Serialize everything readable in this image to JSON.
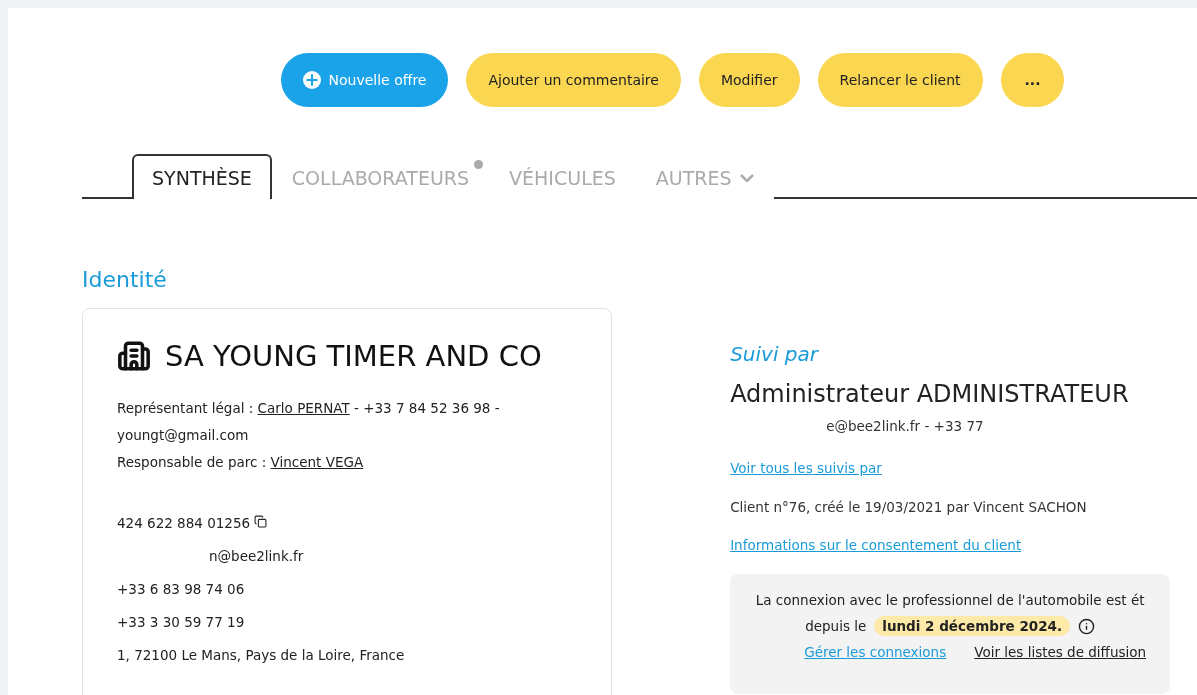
{
  "actions": [
    {
      "label": "Nouvelle offre",
      "kind": "primary"
    },
    {
      "label": "Ajouter un commentaire",
      "kind": "secondary"
    },
    {
      "label": "Modifier",
      "kind": "secondary"
    },
    {
      "label": "Relancer le client",
      "kind": "secondary"
    },
    {
      "label": "...",
      "kind": "more"
    }
  ],
  "tabs": [
    {
      "label": "SYNTHÈSE",
      "selected": true,
      "badge": false,
      "dropdown": false
    },
    {
      "label": "COLLABORATEURS",
      "selected": false,
      "badge": true,
      "dropdown": false
    },
    {
      "label": "VÉHICULES",
      "selected": false,
      "badge": false,
      "dropdown": false
    },
    {
      "label": "AUTRES",
      "selected": false,
      "badge": false,
      "dropdown": true
    }
  ],
  "section_title": "Identité",
  "identity": {
    "company": "SA YOUNG TIMER AND CO",
    "legal_rep": {
      "label": "Représentant légal : ",
      "name": "Carlo PERNAT",
      "details": " - +33 7 84 52 36 98 - youngt@gmail.com"
    },
    "fleet_manager": {
      "label": "Responsable de parc : ",
      "name": "Vincent VEGA"
    },
    "siret": "424 622 884 01256",
    "email": "n@bee2link.fr",
    "phones": [
      "+33 6 83 98 74 06",
      "+33 3 30 59 77 19"
    ],
    "address": "1, 72100 Le Mans, Pays de la Loire, France"
  },
  "followed": {
    "label": "Suivi par",
    "name": "Administrateur ADMINISTRATEUR",
    "contact": "e@bee2link.fr - +33 77",
    "see_all": "Voir tous les suivis par",
    "client_info": "Client n°76, créé le 19/03/2021 par Vincent SACHON",
    "consent": "Informations sur le consentement du client"
  },
  "connection": {
    "text": "La connexion avec le professionnel de l'automobile est ét",
    "since": "depuis le",
    "date": "lundi 2 décembre 2024.",
    "links": [
      {
        "label": "Gérer les connexions",
        "kind": "accent"
      },
      {
        "label": "Voir les listes de diffusion",
        "kind": "plain"
      }
    ]
  }
}
